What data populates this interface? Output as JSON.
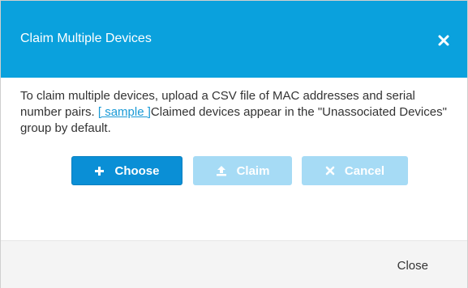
{
  "dialog": {
    "title": "Claim Multiple Devices",
    "close_icon": "close-x-icon",
    "header_color": "#0aa1dd"
  },
  "body": {
    "text_before_link": "To claim multiple devices, upload a CSV file of MAC addresses and serial number pairs. ",
    "link_text": "[ sample ]",
    "text_after_link": "Claimed devices appear in the \"Unassociated Devices\" group by default."
  },
  "actions": {
    "choose_label": "Choose",
    "choose_icon": "plus-icon",
    "claim_label": "Claim",
    "claim_icon": "upload-icon",
    "cancel_label": "Cancel",
    "cancel_icon": "x-icon",
    "primary_color": "#0a8fd6",
    "disabled_color": "#a6dbf5"
  },
  "footer": {
    "close_label": "Close"
  }
}
